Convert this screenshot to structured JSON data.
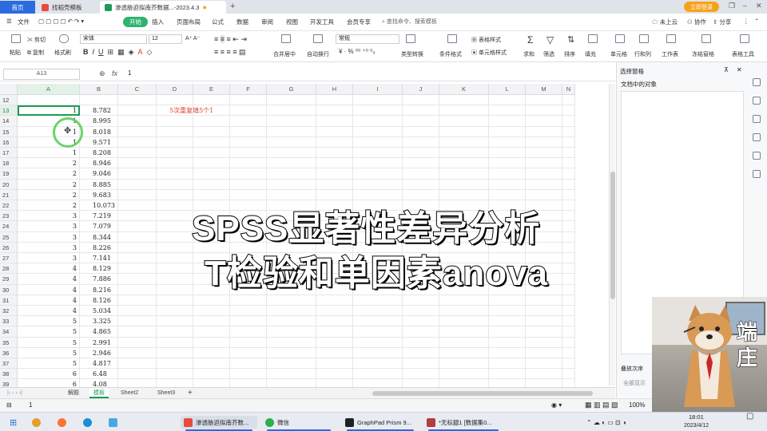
{
  "tabs": [
    {
      "label": "首页"
    },
    {
      "label": "找稻壳模板"
    },
    {
      "label": "渗透胁迫拟南芥数据...-2023.4.3"
    }
  ],
  "login_button": "立即登录",
  "menu": {
    "file": "文件",
    "items": [
      "开始",
      "插入",
      "页面布局",
      "公式",
      "数据",
      "审阅",
      "视图",
      "开发工具",
      "会员专享"
    ],
    "active": "开始",
    "search": "查找命令、搜索模板",
    "cloud": "未上云",
    "collab": "协作",
    "share": "分享"
  },
  "ribbon": {
    "cut": "剪切",
    "copy": "复制",
    "format_painter": "格式刷",
    "paste": "粘贴",
    "font_name": "宋体",
    "font_size": "12",
    "merge": "合并居中",
    "wrap": "自动换行",
    "number_format": "常规",
    "convert": "类型转换",
    "cond_format": "条件格式",
    "table_style": "表格样式",
    "cell_style": "单元格样式",
    "sum": "求和",
    "filter": "筛选",
    "sort": "排序",
    "fill": "填充",
    "cells": "单元格",
    "rowcol": "行和列",
    "worksheet": "工作表",
    "freeze": "冻结窗格",
    "tools": "表格工具"
  },
  "formula_bar": {
    "name_box": "A13",
    "fx": "fx",
    "value": "1"
  },
  "columns": [
    "A",
    "B",
    "C",
    "D",
    "E",
    "F",
    "G",
    "H",
    "I",
    "J",
    "K",
    "L",
    "M",
    "N"
  ],
  "rows": [
    {
      "n": "12",
      "a": "",
      "b": ""
    },
    {
      "n": "13",
      "a": "1",
      "b": "8.782"
    },
    {
      "n": "14",
      "a": "1",
      "b": "8.995"
    },
    {
      "n": "15",
      "a": "1",
      "b": "8.018"
    },
    {
      "n": "16",
      "a": "1",
      "b": "9.571"
    },
    {
      "n": "17",
      "a": "1",
      "b": "8.208"
    },
    {
      "n": "18",
      "a": "2",
      "b": "8.946"
    },
    {
      "n": "19",
      "a": "2",
      "b": "9.046"
    },
    {
      "n": "20",
      "a": "2",
      "b": "8.885"
    },
    {
      "n": "21",
      "a": "2",
      "b": "9.683"
    },
    {
      "n": "22",
      "a": "2",
      "b": "10.073"
    },
    {
      "n": "23",
      "a": "3",
      "b": "7.219"
    },
    {
      "n": "24",
      "a": "3",
      "b": "7.079"
    },
    {
      "n": "25",
      "a": "3",
      "b": "8.344"
    },
    {
      "n": "26",
      "a": "3",
      "b": "8.226"
    },
    {
      "n": "27",
      "a": "3",
      "b": "7.141"
    },
    {
      "n": "28",
      "a": "4",
      "b": "8.129"
    },
    {
      "n": "29",
      "a": "4",
      "b": "7.886"
    },
    {
      "n": "30",
      "a": "4",
      "b": "8.216"
    },
    {
      "n": "31",
      "a": "4",
      "b": "8.126"
    },
    {
      "n": "32",
      "a": "4",
      "b": "5.034"
    },
    {
      "n": "33",
      "a": "5",
      "b": "3.325"
    },
    {
      "n": "34",
      "a": "5",
      "b": "4.865"
    },
    {
      "n": "35",
      "a": "5",
      "b": "2.991"
    },
    {
      "n": "36",
      "a": "5",
      "b": "2.946"
    },
    {
      "n": "37",
      "a": "5",
      "b": "4.817"
    },
    {
      "n": "38",
      "a": "6",
      "b": "6.48"
    },
    {
      "n": "39",
      "a": "6",
      "b": "4.08"
    }
  ],
  "note": "5次重复填5个1",
  "overlay": {
    "line1": "SPSS显著性差异分析",
    "line2": "T检验和单因素anova"
  },
  "sheets": [
    {
      "label": "解题"
    },
    {
      "label": "模板"
    },
    {
      "label": "Sheet2"
    },
    {
      "label": "Sheet3"
    }
  ],
  "active_sheet": "模板",
  "status": {
    "left": "1",
    "zoom": "100%"
  },
  "right_panel": {
    "title": "选择窗格",
    "objects_label": "文档中的对象",
    "order_label": "叠放次序",
    "show_all": "全部显示"
  },
  "taskbar": {
    "apps": [
      {
        "label": "渗透胁迫拟南芥数..."
      },
      {
        "label": "微信"
      },
      {
        "label": "GraphPad Prism 9..."
      },
      {
        "label": "*无标题1 [数据集0..."
      }
    ]
  },
  "webcam": {
    "name": "端庄",
    "time": "18:01",
    "date": "2023/4/12"
  },
  "colors": {
    "accent_green": "#1f9a55",
    "brand_blue": "#2b6be0",
    "note_red": "#e0442f"
  }
}
